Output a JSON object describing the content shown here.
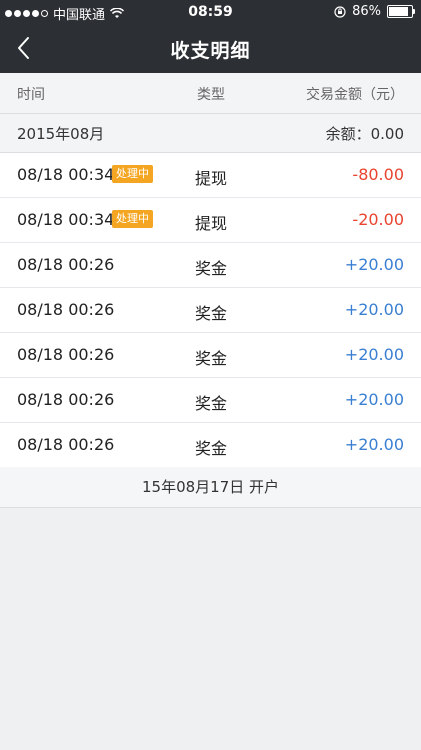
{
  "status_bar": {
    "carrier": "中国联通",
    "time": "08:59",
    "battery_percent": "86%",
    "battery_level": 0.86
  },
  "nav": {
    "back_icon": "chevron-left-icon",
    "title": "收支明细"
  },
  "columns": {
    "time": "时间",
    "type": "类型",
    "amount": "交易金额（元）"
  },
  "month": {
    "label": "2015年08月",
    "balance": "余额：0.00"
  },
  "transactions": [
    {
      "time": "08/18 00:34",
      "badge": "处理中",
      "type": "提现",
      "amount": "-80.00",
      "sign": "neg"
    },
    {
      "time": "08/18 00:34",
      "badge": "处理中",
      "type": "提现",
      "amount": "-20.00",
      "sign": "neg"
    },
    {
      "time": "08/18 00:26",
      "badge": "",
      "type": "奖金",
      "amount": "+20.00",
      "sign": "pos"
    },
    {
      "time": "08/18 00:26",
      "badge": "",
      "type": "奖金",
      "amount": "+20.00",
      "sign": "pos"
    },
    {
      "time": "08/18 00:26",
      "badge": "",
      "type": "奖金",
      "amount": "+20.00",
      "sign": "pos"
    },
    {
      "time": "08/18 00:26",
      "badge": "",
      "type": "奖金",
      "amount": "+20.00",
      "sign": "pos"
    },
    {
      "time": "08/18 00:26",
      "badge": "",
      "type": "奖金",
      "amount": "+20.00",
      "sign": "pos"
    }
  ],
  "footer": {
    "text": "15年08月17日  开户"
  },
  "colors": {
    "header_bg": "#2c2f33",
    "negative": "#e8442f",
    "positive": "#3a7fd2",
    "badge": "#f4a623"
  }
}
